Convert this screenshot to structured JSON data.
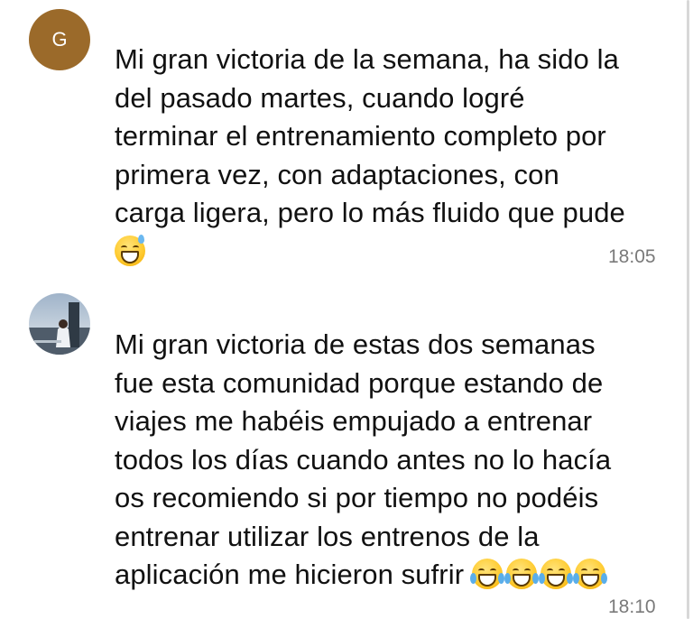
{
  "messages": [
    {
      "avatar_initial": "G",
      "lines": [
        "Mi gran victoria de la semana, ha sido la",
        "del pasado martes, cuando logré",
        "terminar el entrenamiento completo por",
        "primera vez, con adaptaciones, con",
        "carga ligera, pero lo más fluido que pude"
      ],
      "trailing_emoji": "grinning-sweat-emoji",
      "time": "18:05"
    },
    {
      "lines": [
        "Mi gran victoria de estas dos semanas",
        "fue esta comunidad porque estando de",
        "viajes me habéis empujado a entrenar",
        "todos los días cuando antes no lo hacía",
        "os recomiendo si por tiempo no podéis",
        "entrenar utilizar los entrenos de la",
        "aplicación me hicieron sufrir"
      ],
      "trailing_emoji": "tears-of-joy-emoji",
      "trailing_emoji_count": 4,
      "time": "18:10"
    }
  ]
}
